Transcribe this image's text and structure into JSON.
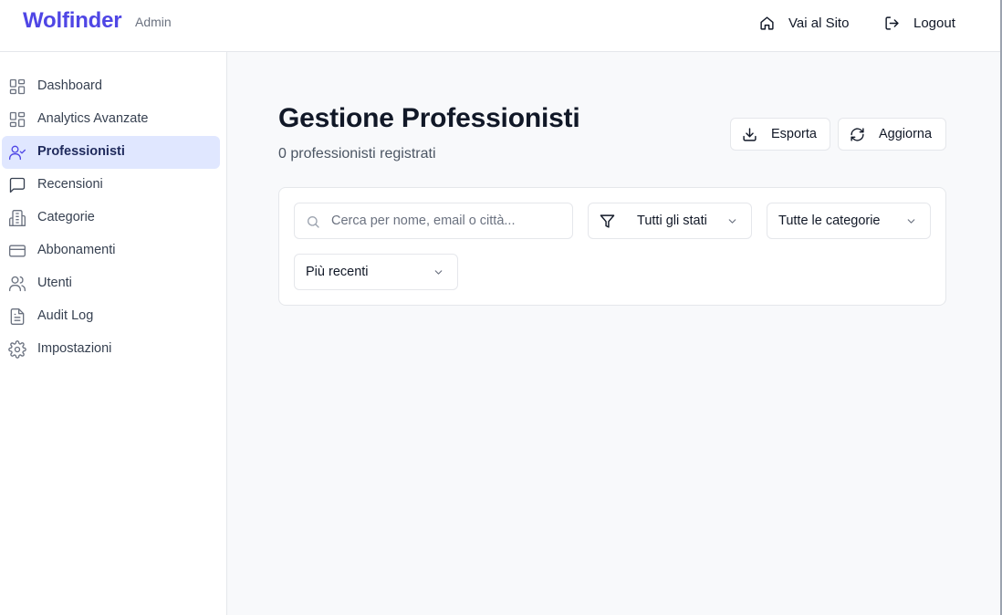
{
  "header": {
    "brand": "Wolfinder",
    "brand_sub": "Admin",
    "site_link": "Vai al Sito",
    "logout": "Logout"
  },
  "sidebar": {
    "items": [
      {
        "label": "Dashboard",
        "icon": "dashboard-grid-icon"
      },
      {
        "label": "Analytics Avanzate",
        "icon": "analytics-grid-icon"
      },
      {
        "label": "Professionisti",
        "icon": "user-check-icon",
        "active": true
      },
      {
        "label": "Recensioni",
        "icon": "message-square-icon"
      },
      {
        "label": "Categorie",
        "icon": "building-icon"
      },
      {
        "label": "Abbonamenti",
        "icon": "credit-card-icon"
      },
      {
        "label": "Utenti",
        "icon": "users-icon"
      },
      {
        "label": "Audit Log",
        "icon": "file-text-icon"
      },
      {
        "label": "Impostazioni",
        "icon": "gear-icon"
      }
    ]
  },
  "main": {
    "title": "Gestione Professionisti",
    "subtitle": "0 professionisti registrati",
    "export_label": "Esporta",
    "refresh_label": "Aggiorna",
    "filters": {
      "search_placeholder": "Cerca per nome, email o città...",
      "status_value": "Tutti gli stati",
      "category_value": "Tutte le categorie",
      "sort_value": "Più recenti"
    }
  },
  "colors": {
    "brand": "#4f46e5",
    "active_bg": "#e0e7ff",
    "page_bg": "#f8f9fb"
  }
}
